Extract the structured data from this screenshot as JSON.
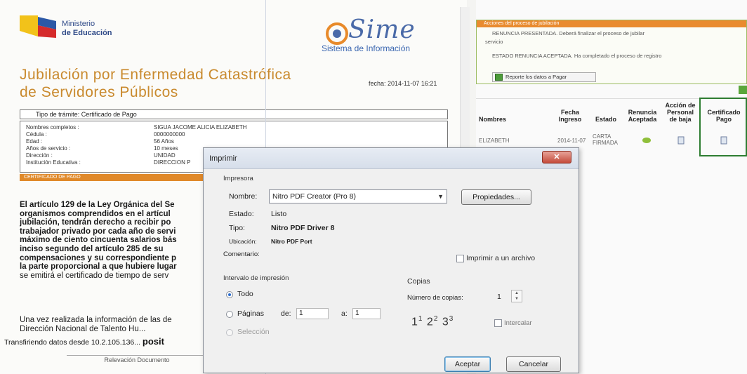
{
  "document": {
    "ministry_line1": "Ministerio",
    "ministry_line2": "de Educación",
    "sime_word": "Sime",
    "sime_subtitle": "Sistema de Información",
    "title_line1": "Jubilación por Enfermedad Catastrófica",
    "title_line2": "de Servidores Públicos",
    "date": "fecha: 2014-11-07 16:21",
    "doc_type_label": "Tipo de trámite: Certificado de Pago",
    "person_rows": [
      {
        "label": "Nombres completos :",
        "value": "SIGUA JACOME ALICIA ELIZABETH"
      },
      {
        "label": "Cédula :",
        "value": "0000000000"
      },
      {
        "label": "Edad :",
        "value": "56 Años"
      },
      {
        "label": "Años de servicio :",
        "value": "10 meses"
      },
      {
        "label": "Dirección :",
        "value": "UNIDAD"
      },
      {
        "label": "Institución Educativa :",
        "value": "DIRECCION P"
      }
    ],
    "section_label": "CERTIFICADO DE PAGO",
    "body_lines": [
      "El artículo 129 de la Ley Orgánica del Se",
      "organismos comprendidos en el artícul",
      "jubilación, tendrán derecho a recibir po",
      "trabajador privado por cada año de servi",
      "máximo de ciento cincuenta salarios bás",
      "inciso segundo del artículo 285 de su",
      "compensaciones y su correspondiente p",
      "la parte proporcional a que hubiere lugar",
      "se emitirá el certificado de tiempo de serv"
    ],
    "bottom_line1": "Una vez realizada la información de las de",
    "bottom_line2": "Dirección Nacional de Talento Hu...",
    "status_text": "Transfiriendo datos desde 10.2.105.136...",
    "status_tail": "posit",
    "bottom_tab": "Relevación Documento"
  },
  "right_panel": {
    "notif_header": "Acciones del proceso de jubilación",
    "notif_line1": "RENUNCIA PRESENTADA. Deberá finalizar el proceso de jubilar",
    "notif_line1b": "servicio",
    "notif_line2": "ESTADO RENUNCIA ACEPTADA. Ha completado el proceso de registro",
    "notif_button": "Reporte los datos a Pagar",
    "headers": [
      "Nombres",
      "Fecha Ingreso",
      "Estado",
      "Renuncia Aceptada",
      "Acción de Personal de baja",
      "Certificado Pago"
    ],
    "row": {
      "name": "ELIZABETH",
      "date": "2014-11-07",
      "status": "CARTA FIRMADA"
    }
  },
  "dialog": {
    "title": "Imprimir",
    "close": "✕",
    "group_printer": "Impresora",
    "name_label": "Nombre:",
    "printer_name": "Nitro PDF Creator (Pro 8)",
    "properties_button": "Propiedades...",
    "status_label": "Estado:",
    "status_value": "Listo",
    "type_label": "Tipo:",
    "type_value": "Nitro PDF Driver 8",
    "location_label": "Ubicación:",
    "location_value": "Nitro PDF Port",
    "comment_label": "Comentario:",
    "print_to_file": "Imprimir a un archivo",
    "range_group": "Intervalo de impresión",
    "all_label": "Todo",
    "pages_label": "Páginas",
    "from_label": "de:",
    "from_value": "1",
    "to_label": "a:",
    "to_value": "1",
    "selection_label": "Selección",
    "copies_group": "Copias",
    "copies_label": "Número de copias:",
    "copies_value": "1",
    "collate_label": "Intercalar",
    "ok_button": "Aceptar",
    "cancel_button": "Cancelar"
  },
  "colors": {
    "title_orange": "#c98a2e",
    "section_orange": "#e0892a",
    "sime_blue": "#4a6aa8",
    "highlight_green": "#2e7d32"
  }
}
